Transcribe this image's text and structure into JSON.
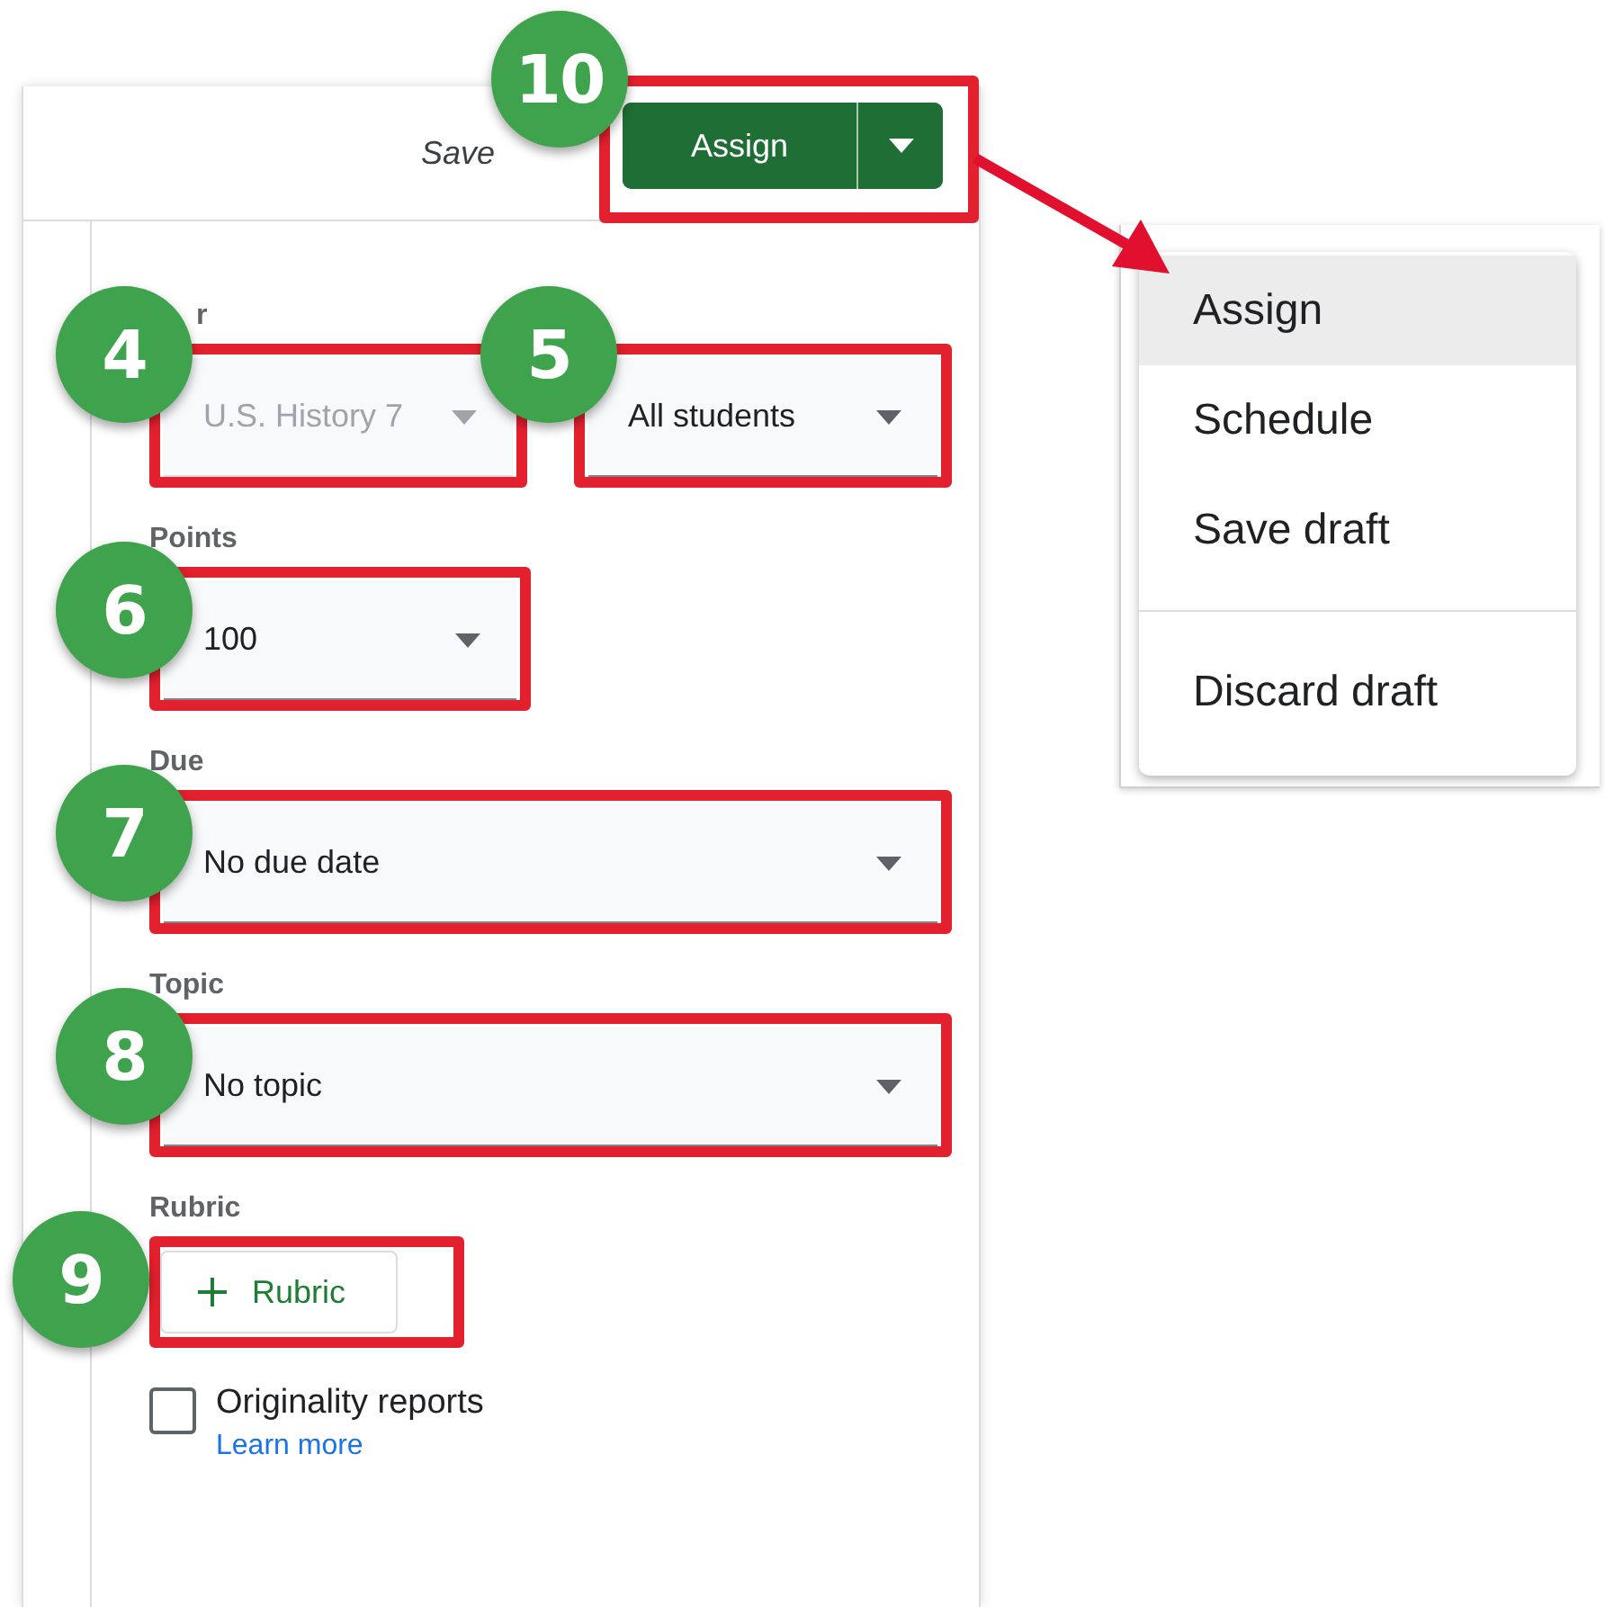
{
  "header": {
    "save_status": "Save",
    "assign_button": {
      "label": "Assign",
      "badge": "10"
    }
  },
  "sections": [
    {
      "label": "r",
      "controls": [
        {
          "kind": "select",
          "value": "U.S. History 7",
          "disabled": true,
          "badge": "4"
        },
        {
          "kind": "select",
          "value": "All students",
          "disabled": false,
          "badge": "5"
        }
      ]
    },
    {
      "label": "Points",
      "controls": [
        {
          "kind": "select",
          "value": "100",
          "disabled": false,
          "badge": "6"
        }
      ]
    },
    {
      "label": "Due",
      "controls": [
        {
          "kind": "select",
          "value": "No due date",
          "disabled": false,
          "badge": "7"
        }
      ]
    },
    {
      "label": "Topic",
      "controls": [
        {
          "kind": "select",
          "value": "No topic",
          "disabled": false,
          "badge": "8"
        }
      ]
    },
    {
      "label": "Rubric",
      "controls": [
        {
          "kind": "button",
          "value": "Rubric",
          "badge": "9"
        }
      ]
    }
  ],
  "originality": {
    "label": "Originality reports",
    "checked": false,
    "link": "Learn more"
  },
  "assign_menu": {
    "items": [
      {
        "label": "Assign",
        "selected": true,
        "divider_before": false
      },
      {
        "label": "Schedule",
        "selected": false,
        "divider_before": false
      },
      {
        "label": "Save draft",
        "selected": false,
        "divider_before": false
      },
      {
        "label": "Discard draft",
        "selected": false,
        "divider_before": true
      }
    ]
  }
}
